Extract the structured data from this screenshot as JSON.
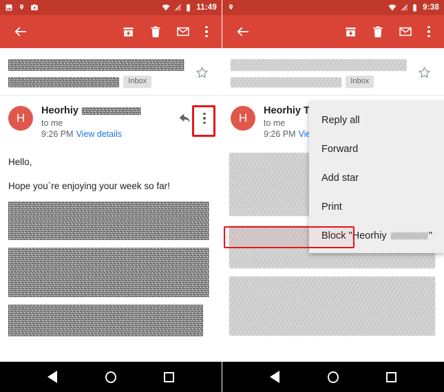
{
  "app": {
    "name": "Gmail",
    "accent_color": "#d94436",
    "statusbar_color": "#c0392b",
    "link_color": "#1a73e8",
    "highlight_color": "#e5141a",
    "avatar_color": "#e0584c",
    "menu_bg_color": "#eeeeee"
  },
  "left_panel": {
    "statusbar": {
      "icons_left": [
        "image-icon",
        "location-pin-icon",
        "media-camera-icon"
      ],
      "icons_right": [
        "wifi-icon",
        "signal-off-icon",
        "battery-icon"
      ],
      "time": "11:49"
    },
    "toolbar": {
      "back_label": "Back",
      "actions": [
        {
          "name": "archive-icon",
          "label": "Archive"
        },
        {
          "name": "delete-icon",
          "label": "Delete"
        },
        {
          "name": "mark-unread-icon",
          "label": "Mark unread"
        },
        {
          "name": "overflow-menu-icon",
          "label": "More options"
        }
      ]
    },
    "message": {
      "subject_redacted": true,
      "label_chip": "Inbox",
      "star_state": "unstarred",
      "sender_name": "Heorhiy",
      "sender_email_redacted": true,
      "recipients": "to me",
      "time": "9:26 PM",
      "details_link": "View details",
      "reply_label": "Reply",
      "overflow_label": "More options",
      "body_line_1": "Hello,",
      "body_line_2": "Hope you`re enjoying your week so far!"
    },
    "highlight": {
      "target": "overflow-menu-icon",
      "note": "red box around message overflow menu"
    },
    "navbar": {
      "back": "back-triangle-icon",
      "home": "home-circle-icon",
      "recents": "recents-square-icon"
    }
  },
  "right_panel": {
    "statusbar": {
      "icons_left": [
        "location-pin-icon"
      ],
      "icons_right": [
        "wifi-icon",
        "signal-off-icon",
        "battery-icon"
      ],
      "time": "9:38"
    },
    "toolbar": {
      "back_label": "Back",
      "actions": [
        {
          "name": "archive-icon",
          "label": "Archive"
        },
        {
          "name": "delete-icon",
          "label": "Delete"
        },
        {
          "name": "mark-unread-icon",
          "label": "Mark unread"
        },
        {
          "name": "overflow-menu-icon",
          "label": "More options"
        }
      ]
    },
    "message": {
      "subject_redacted": true,
      "label_chip": "Inbox",
      "star_state": "unstarred",
      "sender_name": "Heorhiy To",
      "recipients": "to me",
      "time": "9:26 PM",
      "details_link": "Vie"
    },
    "menu": {
      "items": [
        {
          "label": "Reply all",
          "highlighted": false
        },
        {
          "label": "Forward",
          "highlighted": false
        },
        {
          "label": "Add star",
          "highlighted": false
        },
        {
          "label": "Print",
          "highlighted": false
        },
        {
          "label": "Block \"Heorhiy",
          "suffix": "\"",
          "highlighted": true,
          "name_redacted": true
        }
      ]
    },
    "highlight": {
      "target": "menu-item-block",
      "note": "red box around Block menu item"
    },
    "navbar": {
      "back": "back-triangle-icon",
      "home": "home-circle-icon",
      "recents": "recents-square-icon"
    }
  }
}
